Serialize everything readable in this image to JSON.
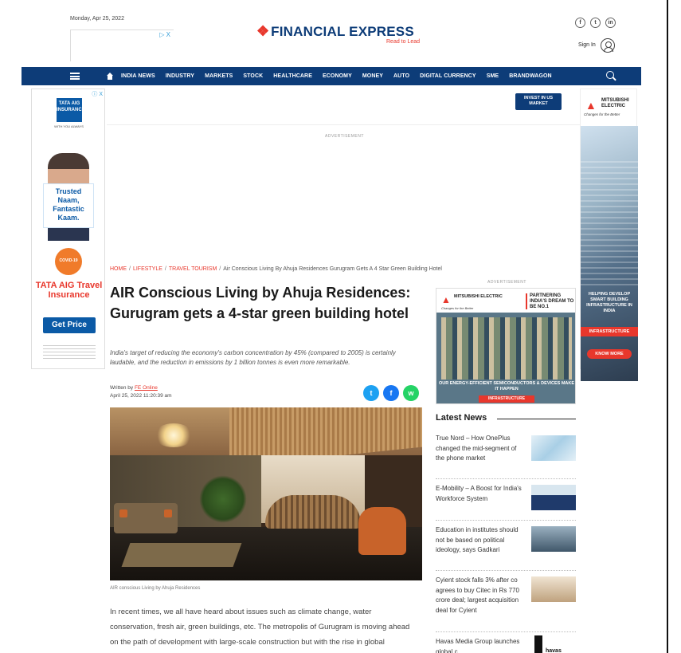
{
  "header": {
    "date": "Monday, Apr 25, 2022",
    "ad_marker": "▷ X",
    "logo_text": "FINANCIAL EXPRESS",
    "tagline": "Read to Lead",
    "social": [
      "f",
      "t",
      "in"
    ],
    "signin": "Sign In"
  },
  "nav": {
    "items": [
      "INDIA NEWS",
      "INDUSTRY",
      "MARKETS",
      "STOCK",
      "HEALTHCARE",
      "ECONOMY",
      "MONEY",
      "AUTO",
      "DIGITAL CURRENCY",
      "SME",
      "BRANDWAGON"
    ]
  },
  "left_ad": {
    "brand": "TATA AIG",
    "brand_sub": "INSURANCE",
    "tag": "WITH YOU ALWAYS",
    "trusted": "Trusted Naam, Fantastic Kaam.",
    "covid": "COVID-19",
    "product": "TATA AIG Travel Insurance",
    "cta": "Get Price",
    "adchoices": "ⓘ X"
  },
  "top_ad": {
    "invest": "INVEST IN US MARKET",
    "label": "ADVERTISEMENT"
  },
  "right_ad": {
    "brand": "MITSUBISHI ELECTRIC",
    "tag": "Changes for the Better",
    "headline": "HELPING DEVELOP SMART BUILDING INFRASTRUCTURE IN INDIA",
    "category": "INFRASTRUCTURE",
    "cta": "KNOW MORE"
  },
  "breadcrumb": {
    "home": "HOME",
    "lifestyle": "LIFESTYLE",
    "travel": "TRAVEL TOURISM",
    "current": "Air Conscious Living By Ahuja Residences Gurugram Gets A 4 Star Green Building Hotel"
  },
  "article": {
    "title": "AIR Conscious Living by Ahuja Residences: Gurugram gets a 4-star green building hotel",
    "summary": "India's target of reducing the economy's carbon concentration by 45% (compared to 2005) is certainly laudable, and the reduction in emissions by 1 billion tonnes is even more remarkable.",
    "written_by": "Written by",
    "author": "FE Online",
    "published": "April 25, 2022 11:20:39 am",
    "share": [
      "t",
      "f",
      "w"
    ],
    "caption": "AIR conscious Living by Ahuja Residences",
    "body": "In recent times, we all have heard about issues such as climate change, water conservation, fresh air, green buildings, etc. The metropolis of Gurugram is moving ahead on the path of development with large-scale construction but with the rise in global temperatures, people living in mega cities like Gurugram"
  },
  "sidebar": {
    "adv_label": "ADVERTISEMENT",
    "ad": {
      "brand": "MITSUBISHI ELECTRIC",
      "tag": "Changes for the Better",
      "headline": "PARTNERING INDIA'S DREAM TO BE NO.1",
      "sub": "OUR ENERGY-EFFICIENT SEMICONDUCTORS & DEVICES MAKE IT HAPPEN",
      "category": "INFRASTRUCTURE"
    },
    "latest_title": "Latest News",
    "news": [
      "True Nord – How OnePlus changed the mid-segment of the phone market",
      "E-Mobility – A Boost for India's Workforce System",
      "Education in institutes should not be based on political ideology, says Gadkari",
      "Cyient stock falls 3% after co agrees to buy Citec in Rs 770 crore deal; largest acquisition deal for Cyient",
      "Havas Media Group launches global c..."
    ],
    "thumb_text": "havas"
  }
}
